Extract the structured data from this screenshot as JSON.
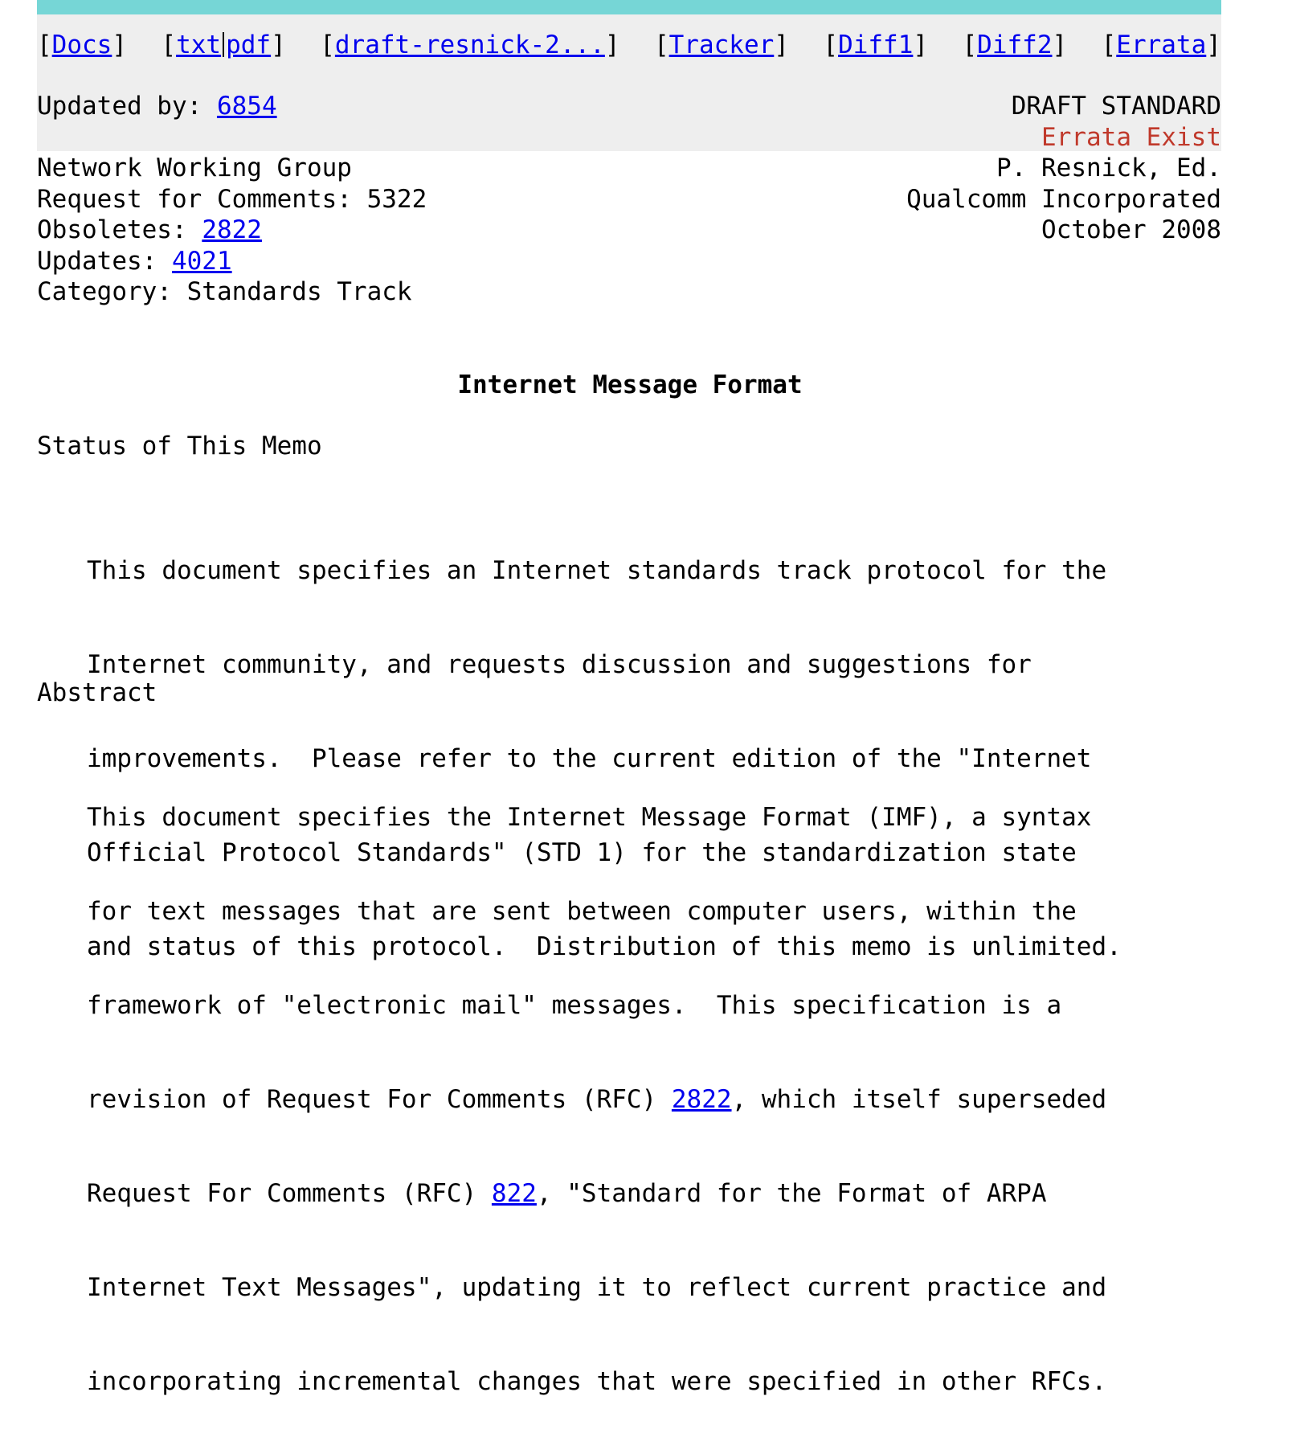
{
  "colors": {
    "top_bar": "#76d6d6",
    "nav_bg": "#eeeeee",
    "link": "#0000ee",
    "errata": "#c0392b"
  },
  "nav": {
    "docs": "Docs",
    "txt": "txt",
    "pdf": "pdf",
    "draft": "draft-resnick-2...",
    "tracker": "Tracker",
    "diff1": "Diff1",
    "diff2": "Diff2",
    "errata": "Errata"
  },
  "header": {
    "updated_by_label": "Updated by: ",
    "updated_by_link": "6854",
    "status": "DRAFT STANDARD",
    "errata_exist": "Errata Exist"
  },
  "meta": {
    "group": "Network Working Group",
    "rfc": "Request for Comments: 5322",
    "obsoletes_label": "Obsoletes: ",
    "obsoletes_link": "2822",
    "updates_label": "Updates: ",
    "updates_link": "4021",
    "category": "Category: Standards Track",
    "author": "P. Resnick, Ed.",
    "org": "Qualcomm Incorporated",
    "date": "October 2008"
  },
  "title": "Internet Message Format",
  "status_memo": {
    "heading": "Status of This Memo",
    "lines": [
      "This document specifies an Internet standards track protocol for the",
      "Internet community, and requests discussion and suggestions for",
      "improvements.  Please refer to the current edition of the \"Internet",
      "Official Protocol Standards\" (STD 1) for the standardization state",
      "and status of this protocol.  Distribution of this memo is unlimited."
    ]
  },
  "abstract": {
    "heading": "Abstract",
    "line1": "This document specifies the Internet Message Format (IMF), a syntax",
    "line2": "for text messages that are sent between computer users, within the",
    "line3": "framework of \"electronic mail\" messages.  This specification is a",
    "line4_pre": "revision of Request For Comments (RFC) ",
    "line4_link": "2822",
    "line4_post": ", which itself superseded",
    "line5_pre": "Request For Comments (RFC) ",
    "line5_link": "822",
    "line5_post": ", \"Standard for the Format of ARPA",
    "line6": "Internet Text Messages\", updating it to reflect current practice and",
    "line7": "incorporating incremental changes that were specified in other RFCs."
  }
}
